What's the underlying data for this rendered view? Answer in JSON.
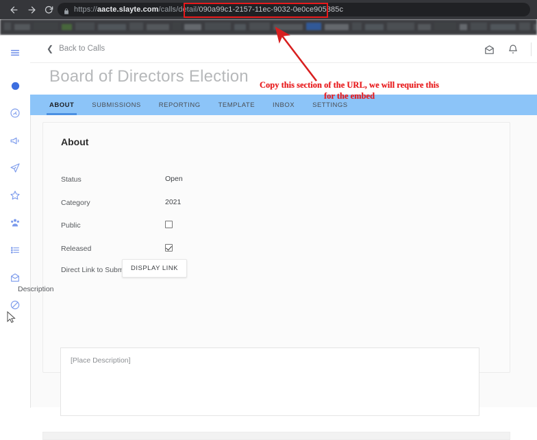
{
  "browser": {
    "back_icon": "back-arrow-icon",
    "forward_icon": "forward-arrow-icon",
    "reload_icon": "reload-icon",
    "lock_icon": "lock-icon",
    "url_scheme": "https://",
    "url_host": "aacte.slayte.com",
    "url_path": "/calls/detail/",
    "url_uuid": "090a99c1-2157-11ec-9032-0e0ce905385c",
    "full_url": "https://aacte.slayte.com/calls/detail/090a99c1-2157-11ec-9032-0e0ce905385c"
  },
  "annotation": {
    "line1": "Copy this section of the URL, we will require this",
    "line2": "for the embed",
    "highlight_color": "#e8191b"
  },
  "sidebar": {
    "items": [
      {
        "name": "menu-toggle",
        "icon": "hamburger-menu-icon"
      },
      {
        "name": "brand-dot",
        "icon": "circle-icon"
      },
      {
        "name": "dashboard",
        "icon": "gauge-icon"
      },
      {
        "name": "announcements",
        "icon": "megaphone-icon"
      },
      {
        "name": "calls",
        "icon": "paper-plane-icon"
      },
      {
        "name": "favorites",
        "icon": "star-icon"
      },
      {
        "name": "members",
        "icon": "people-icon"
      },
      {
        "name": "lists",
        "icon": "list-icon"
      },
      {
        "name": "inbox",
        "icon": "envelope-icon"
      },
      {
        "name": "blocked",
        "icon": "prohibited-icon"
      }
    ]
  },
  "topbar": {
    "back_label": "Back to Calls",
    "back_icon": "chevron-left-icon",
    "mail_icon": "envelope-icon",
    "bell_icon": "bell-icon"
  },
  "header": {
    "title": "Board of Directors Election"
  },
  "tabs": [
    {
      "label": "ABOUT",
      "active": true
    },
    {
      "label": "SUBMISSIONS",
      "active": false
    },
    {
      "label": "REPORTING",
      "active": false
    },
    {
      "label": "TEMPLATE",
      "active": false
    },
    {
      "label": "INBOX",
      "active": false
    },
    {
      "label": "SETTINGS",
      "active": false
    }
  ],
  "about": {
    "heading": "About",
    "fields": [
      {
        "label": "Status",
        "value": "Open",
        "type": "text"
      },
      {
        "label": "Category",
        "value": "2021",
        "type": "text"
      },
      {
        "label": "Public",
        "value": "",
        "type": "checkbox",
        "checked": false
      },
      {
        "label": "Released",
        "value": "",
        "type": "checkbox",
        "checked": true
      }
    ],
    "direct_link_label": "Direct Link to Submission Form",
    "display_link_button": "DISPLAY LINK",
    "description_label": "Description",
    "description_placeholder": "[Place Description]"
  },
  "colors": {
    "tabbar_blue": "#8cc4f8",
    "tab_active_underline": "#4a90e2",
    "sidebar_icon": "#5b7fe8",
    "annotation_red": "#e8191b"
  }
}
